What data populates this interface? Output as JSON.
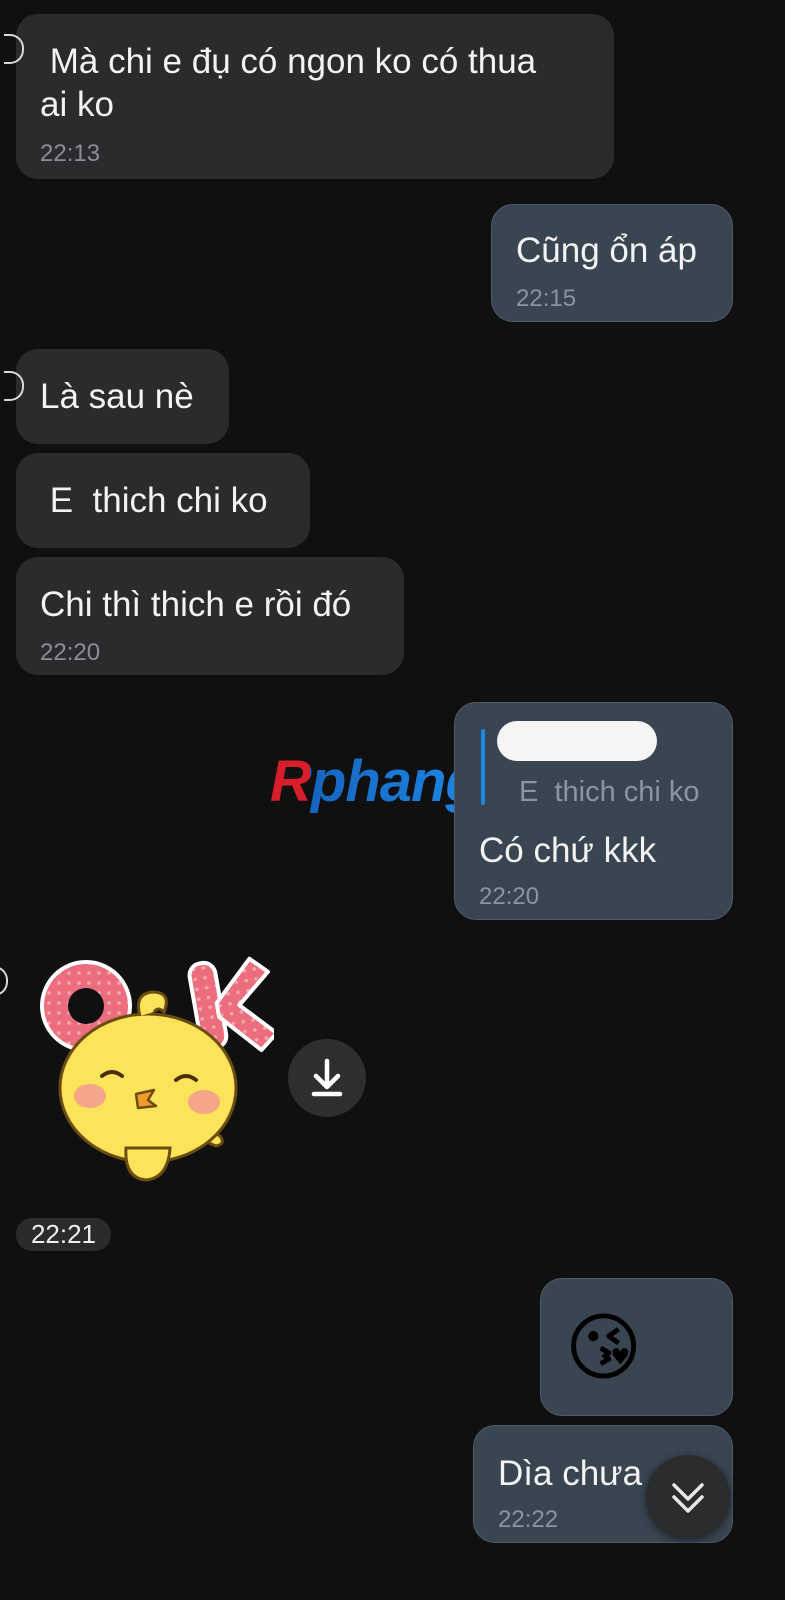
{
  "messages": [
    {
      "text": " Mà chi e đụ có ngon ko có thua\nai ko",
      "time": "22:13"
    },
    {
      "text": "Cũng ổn áp",
      "time": "22:15"
    },
    {
      "text": "Là sau nè"
    },
    {
      "text": " E  thich chi ko"
    },
    {
      "text": "Chi thì thich e rồi đó",
      "time": "22:20"
    },
    {
      "quote": "E  thich chi ko",
      "text": "Có chứ kkk",
      "time": "22:20"
    },
    {
      "sticker": "ok-chick-sticker",
      "time": "22:21"
    },
    {
      "emoji": "😘"
    },
    {
      "text": "Dìa chưa",
      "time": "22:22"
    }
  ],
  "watermark": {
    "text": "Rphang",
    "colors": {
      "first": "#d81e2a",
      "rest": "#1565c0"
    }
  },
  "icons": {
    "download": "download-icon",
    "scroll_down": "chevron-double-down-icon"
  },
  "colors": {
    "background": "#101010",
    "received_bubble": "#2b2b2d",
    "sent_bubble": "#3a4552",
    "quote_bar": "#1e88e5"
  }
}
